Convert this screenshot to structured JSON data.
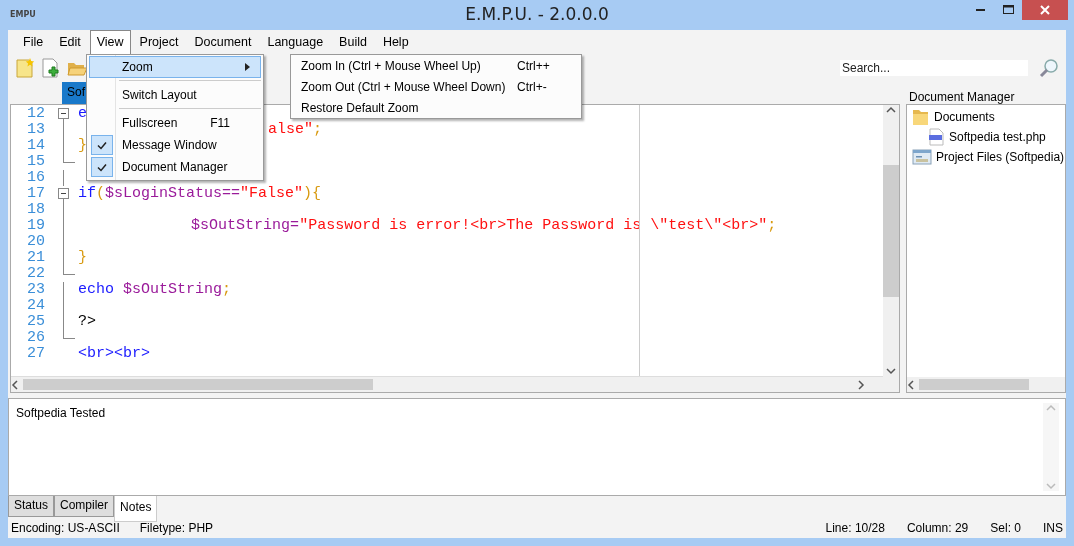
{
  "window": {
    "logo": "EMPU",
    "title": "E.M.P.U. - 2.0.0.0"
  },
  "menu_bar": [
    {
      "label": "File",
      "selected": false
    },
    {
      "label": "Edit",
      "selected": false
    },
    {
      "label": "View",
      "selected": true
    },
    {
      "label": "Project",
      "selected": false
    },
    {
      "label": "Document",
      "selected": false
    },
    {
      "label": "Language",
      "selected": false
    },
    {
      "label": "Build",
      "selected": false
    },
    {
      "label": "Help",
      "selected": false
    }
  ],
  "view_menu": [
    {
      "kind": "submenu",
      "label": "Zoom",
      "selected": true,
      "checked": false
    },
    {
      "kind": "separator"
    },
    {
      "kind": "command",
      "label": "Switch Layout",
      "selected": false,
      "checked": false
    },
    {
      "kind": "separator"
    },
    {
      "kind": "command",
      "label": "Fullscreen",
      "shortcut": "F11",
      "selected": false,
      "checked": false
    },
    {
      "kind": "command",
      "label": "Message Window",
      "selected": false,
      "checked": true
    },
    {
      "kind": "command",
      "label": "Document Manager",
      "selected": false,
      "checked": true
    }
  ],
  "zoom_submenu": [
    {
      "label": "Zoom In (Ctrl + Mouse Wheel Up)",
      "shortcut": "Ctrl++"
    },
    {
      "label": "Zoom Out (Ctrl + Mouse Wheel Down)",
      "shortcut": "Ctrl+-"
    },
    {
      "label": "Restore Default Zoom"
    }
  ],
  "search": {
    "placeholder": "Search..."
  },
  "document_tabs": [
    {
      "label": "Sof",
      "selected": true
    }
  ],
  "editor": {
    "lines": [
      {
        "number": "12",
        "kind": "start",
        "tokens": [
          {
            "kind": "keyword",
            "text": "e"
          }
        ]
      },
      {
        "number": "13",
        "kind": "inside",
        "tokens": [
          {
            "kind": "string",
            "text": "                     alse\""
          },
          {
            "kind": "punct",
            "text": ";"
          }
        ]
      },
      {
        "number": "14",
        "kind": "inside",
        "tokens": [
          {
            "kind": "punct",
            "text": "}"
          }
        ]
      },
      {
        "number": "15",
        "kind": "end"
      },
      {
        "number": "16",
        "kind": "inside"
      },
      {
        "number": "17",
        "kind": "start",
        "tokens": [
          {
            "kind": "keyword",
            "text": "if"
          },
          {
            "kind": "punct",
            "text": "("
          },
          {
            "kind": "variable",
            "text": "$sLoginStatus=="
          },
          {
            "kind": "string",
            "text": "\"False\""
          },
          {
            "kind": "punct",
            "text": "){"
          }
        ]
      },
      {
        "number": "18",
        "kind": "inside"
      },
      {
        "number": "19",
        "kind": "inside",
        "tokens": [
          {
            "kind": "variable",
            "text": "\t\t\t$sOutString="
          },
          {
            "kind": "string",
            "text": "\"Password is error!<br>The Password is \\\"test\\\"<br>\""
          },
          {
            "kind": "punct",
            "text": ";"
          }
        ]
      },
      {
        "number": "20",
        "kind": "inside"
      },
      {
        "number": "21",
        "kind": "inside",
        "tokens": [
          {
            "kind": "punct",
            "text": "}"
          }
        ]
      },
      {
        "number": "22",
        "kind": "end"
      },
      {
        "number": "23",
        "kind": "inside",
        "tokens": [
          {
            "kind": "keyword",
            "text": "echo "
          },
          {
            "kind": "variable",
            "text": "$sOutString"
          },
          {
            "kind": "punct",
            "text": ";"
          }
        ]
      },
      {
        "number": "24",
        "kind": "inside"
      },
      {
        "number": "25",
        "kind": "inside",
        "tokens": [
          {
            "kind": "plain",
            "text": "?>"
          }
        ]
      },
      {
        "number": "26",
        "kind": "end"
      },
      {
        "number": "27",
        "tokens": [
          {
            "kind": "keyword",
            "text": "<br><br>"
          }
        ]
      }
    ]
  },
  "document_manager": {
    "title": "Document Manager",
    "tree": [
      {
        "kind": "folder",
        "label": "Documents",
        "children": [
          {
            "kind": "php",
            "label": "Softpedia test.php"
          }
        ]
      },
      {
        "kind": "project",
        "label": "Project Files (Softpedia)"
      }
    ]
  },
  "message_panel": {
    "text": "Softpedia Tested"
  },
  "bottom_tabs": [
    {
      "label": "Status",
      "selected": false
    },
    {
      "label": "Compiler",
      "selected": false
    },
    {
      "label": "Notes",
      "selected": true
    }
  ],
  "status_bar": {
    "left": [
      "Encoding: US-ASCII",
      "Filetype: PHP"
    ],
    "right": [
      "Line: 10/28",
      "Column: 29",
      "Sel: 0",
      "INS"
    ]
  }
}
